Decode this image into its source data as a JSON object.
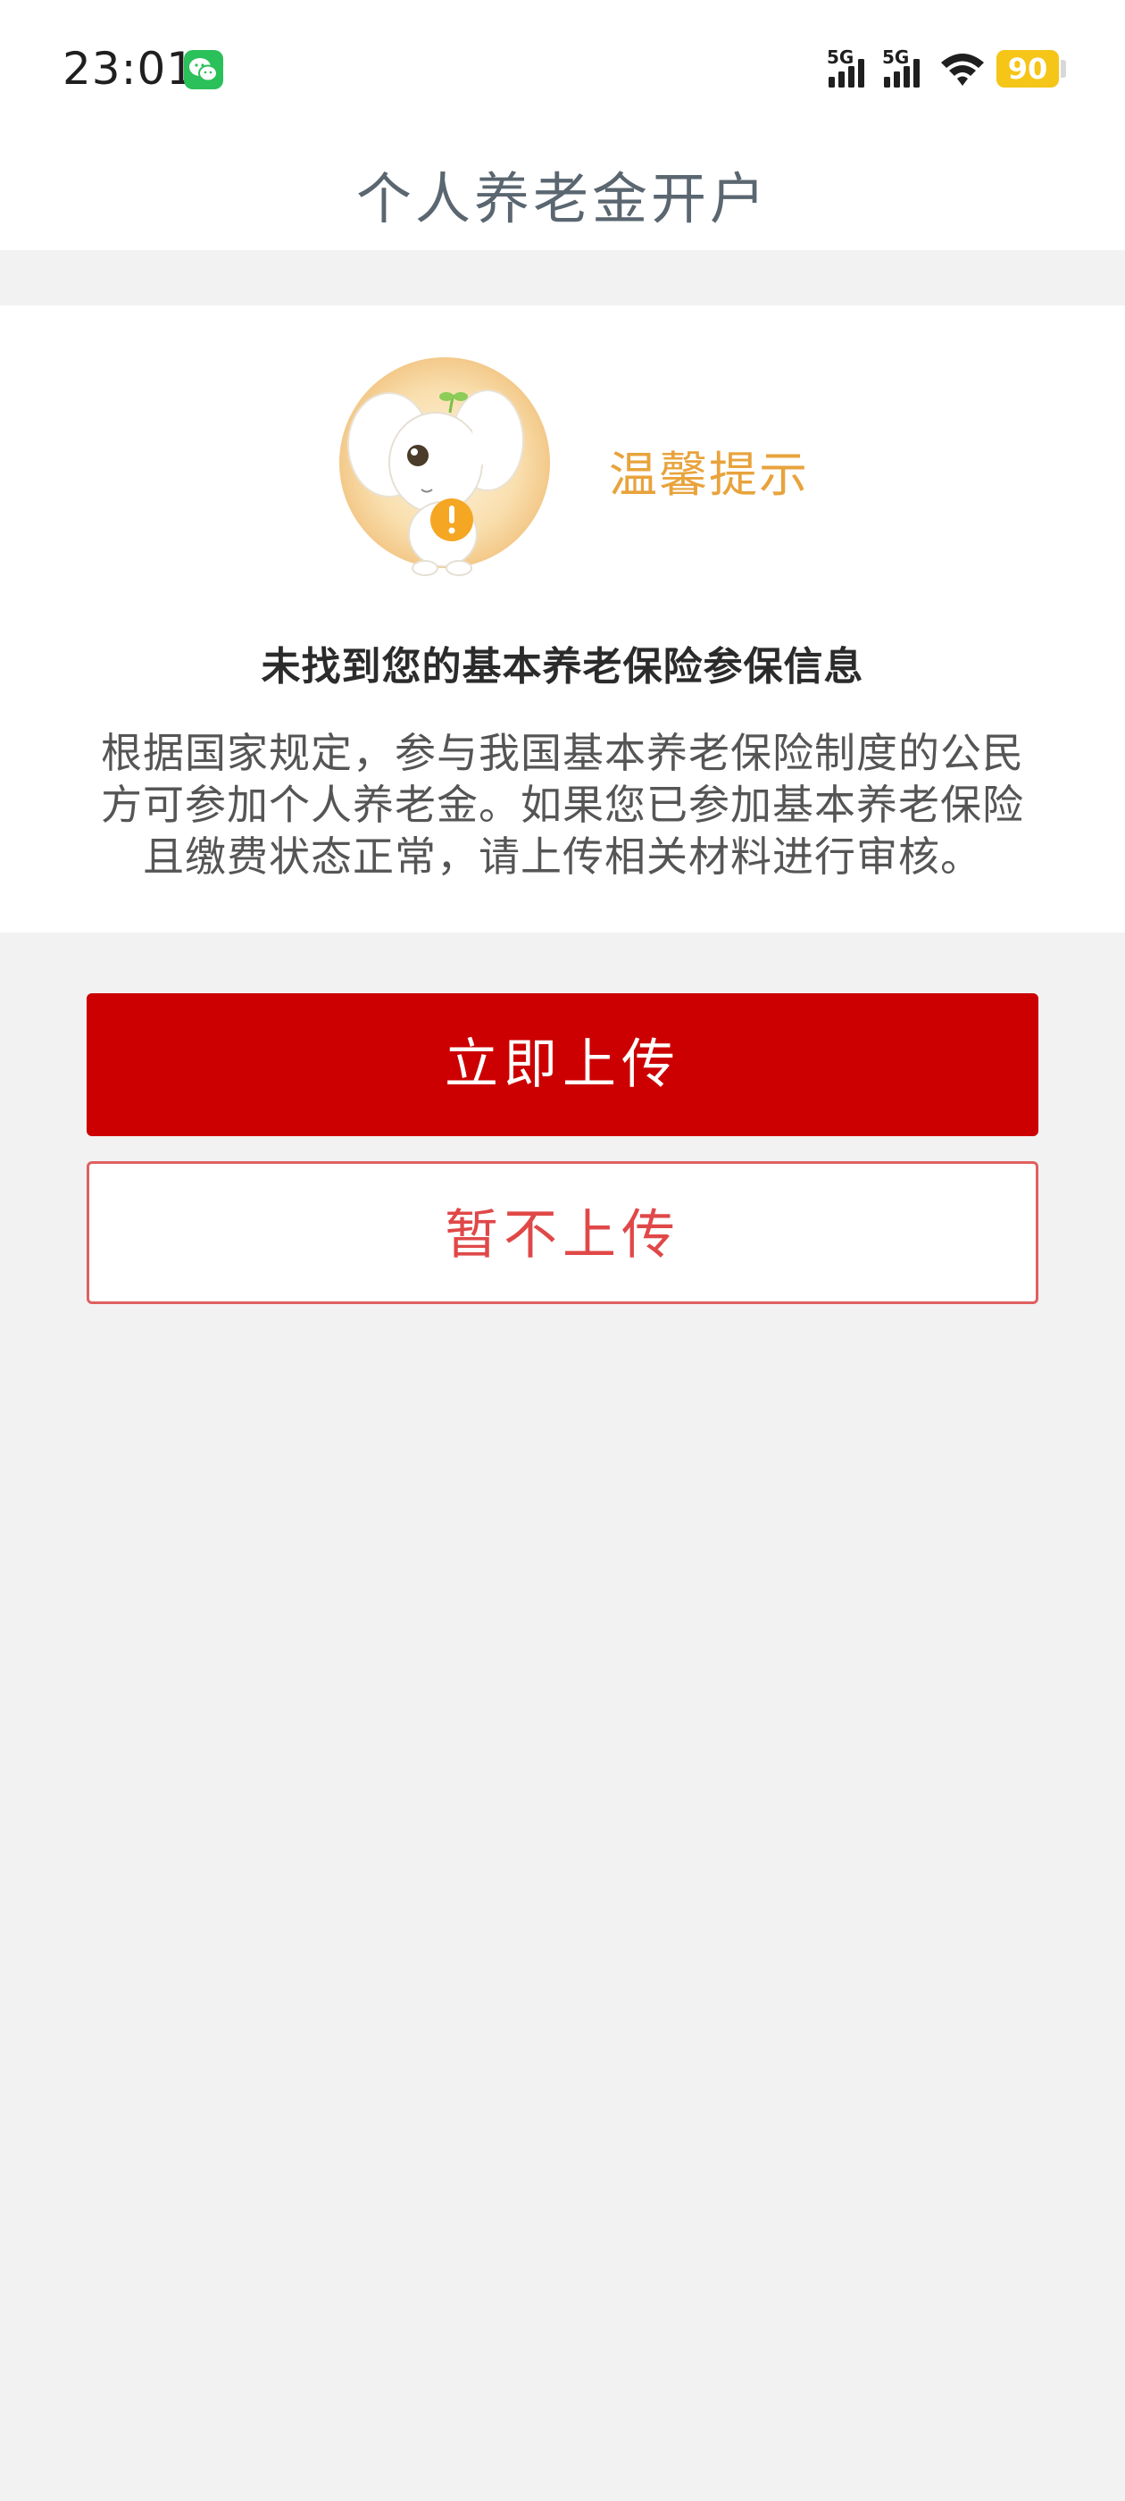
{
  "status_bar": {
    "time": "23:01",
    "app_icon": "wechat-icon",
    "signal_1_label": "5G",
    "signal_2_label": "5G",
    "battery_level": "90"
  },
  "header": {
    "title": "个人养老金开户"
  },
  "notice": {
    "mascot": "elephant-mascot-warning",
    "tip_label": "温馨提示",
    "title": "未找到您的基本养老保险参保信息",
    "body": "根据国家规定，参与我国基本养老保险制度的公民方可参加个人养老金。如果您已参加基本养老保险且缴费状态正常，请上传相关材料进行审核。"
  },
  "actions": {
    "upload_now_label": "立即上传",
    "not_now_label": "暂不上传"
  },
  "colors": {
    "primary": "#cc0000",
    "secondary_text": "#e04848",
    "tip": "#e8a33c",
    "background": "#f2f2f2"
  }
}
